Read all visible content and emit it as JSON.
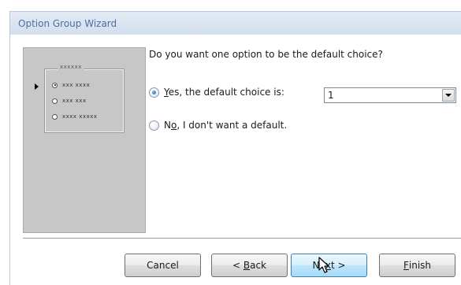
{
  "window": {
    "title": "Option Group Wizard"
  },
  "preview": {
    "frame_caption": "xxxxxx",
    "options": [
      {
        "label": "xxx xxxx",
        "selected": true
      },
      {
        "label": "xxx xxx",
        "selected": false
      },
      {
        "label": "xxxx xxxxx",
        "selected": false
      }
    ]
  },
  "main": {
    "question": "Do you want one option to be the default choice?",
    "option_yes": {
      "label_underlined": "Y",
      "label_rest": "es, the default choice is:",
      "checked": true
    },
    "option_no": {
      "label_prefix": "N",
      "label_underlined": "o",
      "label_rest": ", I don't want a default.",
      "checked": false
    },
    "default_choice": {
      "value": "1"
    }
  },
  "buttons": {
    "cancel": "Cancel",
    "back_prefix": "< ",
    "back_underlined": "B",
    "back_rest": "ack",
    "next_prefix": "Ne",
    "next_underlined": "x",
    "next_rest": "t >",
    "finish_underlined": "F",
    "finish_rest": "inish"
  },
  "colors": {
    "title_text": "#4a6fa0",
    "focus_border": "#3c7fb1",
    "preview_bg": "#c7c7c7"
  }
}
